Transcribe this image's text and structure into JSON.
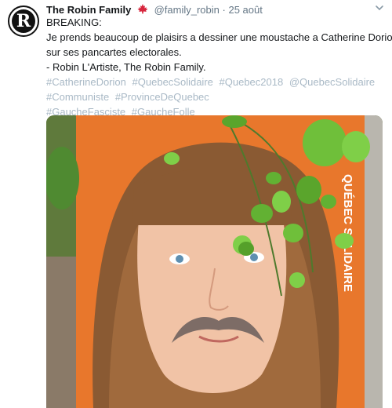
{
  "tweet": {
    "display_name": "The Robin Family",
    "handle": "@family_robin",
    "separator": "·",
    "date": "25 août",
    "avatar_letter": "R",
    "lines": [
      "BREAKING:",
      "Je prends beaucoup de plaisirs a dessiner une moustache a Catherine Dorion",
      "sur ses pancartes electorales.",
      "- Robin L'Artiste, The Robin Family."
    ],
    "hashtag_lines": [
      [
        "#CatherineDorion",
        "#QuebecSolidaire",
        "#Quebec2018",
        "@QuebecSolidaire"
      ],
      [
        "#Communiste",
        "#ProvinceDeQuebec"
      ],
      [
        "#GaucheFasciste",
        "#GaucheFolle"
      ]
    ]
  },
  "poster": {
    "party_text": "QUÉBEC SOLIDAIRE"
  },
  "colors": {
    "hashtag": "#a9b9c6",
    "poster_orange": "#e8772c",
    "flag_red": "#d7263d"
  },
  "icons": [
    "maple-leaf-flag-icon",
    "chevron-down-icon"
  ]
}
